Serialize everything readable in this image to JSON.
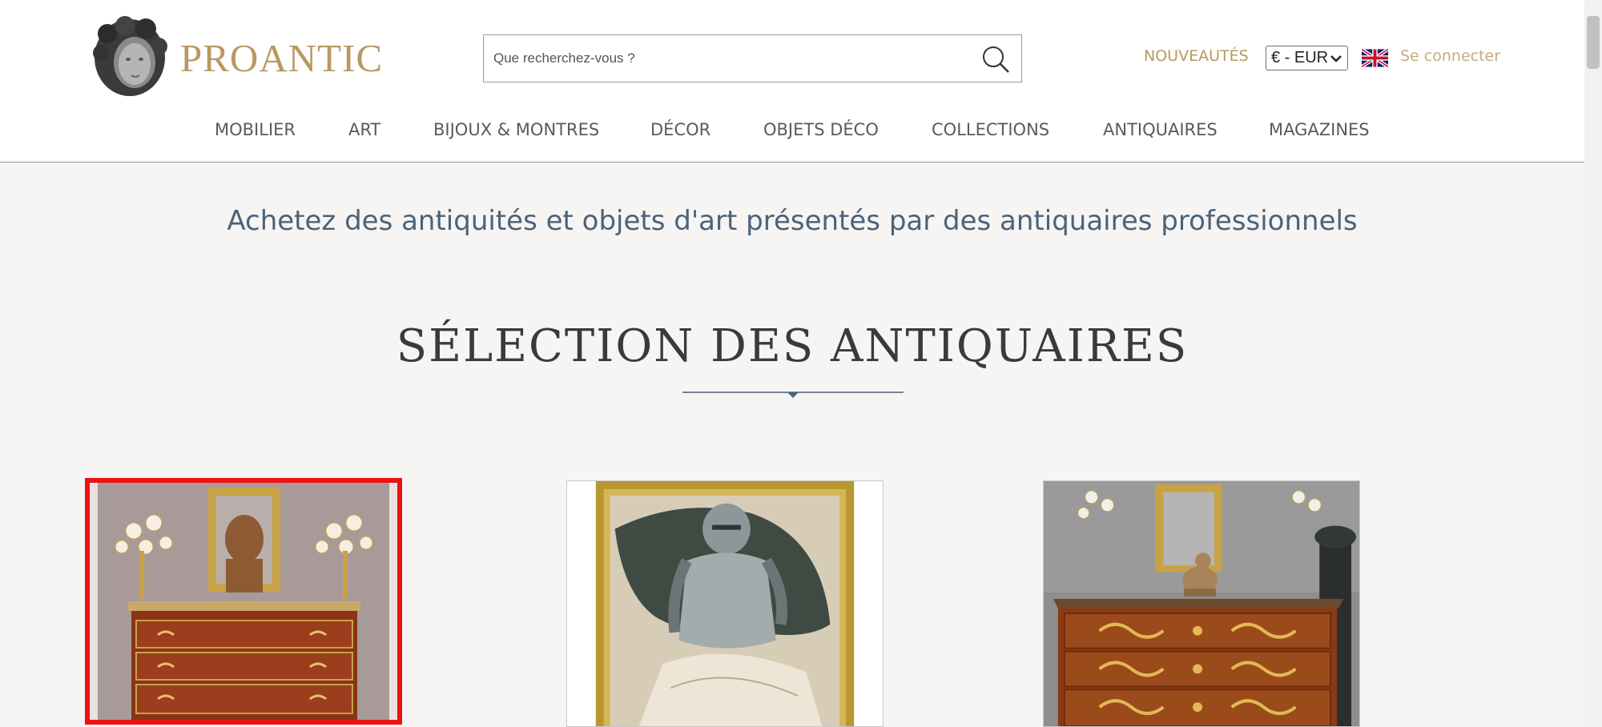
{
  "header": {
    "brand": "PROANTIC",
    "search": {
      "placeholder": "Que recherchez-vous ?"
    },
    "nouveautes": "NOUVEAUTÉS",
    "currency": "€ - EUR",
    "language_flag": "uk-flag-icon",
    "login": "Se connecter"
  },
  "nav": {
    "items": [
      "MOBILIER",
      "ART",
      "BIJOUX & MONTRES",
      "DÉCOR",
      "OBJETS DÉCO",
      "COLLECTIONS",
      "ANTIQUAIRES",
      "MAGAZINES"
    ]
  },
  "main": {
    "tagline": "Achetez des antiquités et objets d'art présentés par des antiquaires professionnels",
    "section_title": "SÉLECTION DES ANTIQUAIRES",
    "cards": [
      {
        "name": "product-card-commode-louis-xvi",
        "selected": true
      },
      {
        "name": "product-card-painting-knight",
        "selected": false
      },
      {
        "name": "product-card-commode-louis-xv",
        "selected": false
      }
    ]
  },
  "colors": {
    "brand_gold": "#b8985f",
    "login_gold": "#c6ad80",
    "tagline_blue": "#4b627a",
    "selection_red": "#ee1111",
    "background": "#f6f5f3"
  }
}
